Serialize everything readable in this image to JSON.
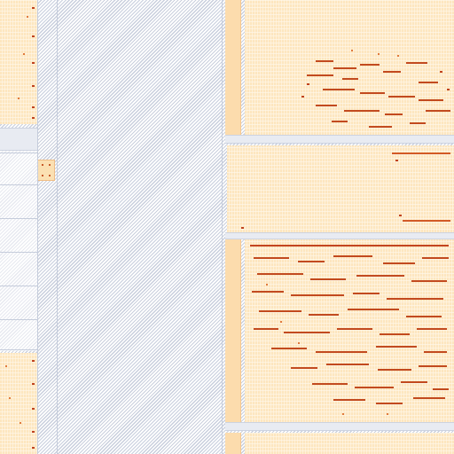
{
  "colors": {
    "panel": "#fde6bf",
    "panel_bar": "#fcdcad",
    "cluster_mark": "#c0421e",
    "cluster_light": "#e07a3e",
    "hatch_line": "#c9cfdd",
    "divider": "#c5ccdb"
  },
  "icons": [
    "corner-cell-icon"
  ]
}
